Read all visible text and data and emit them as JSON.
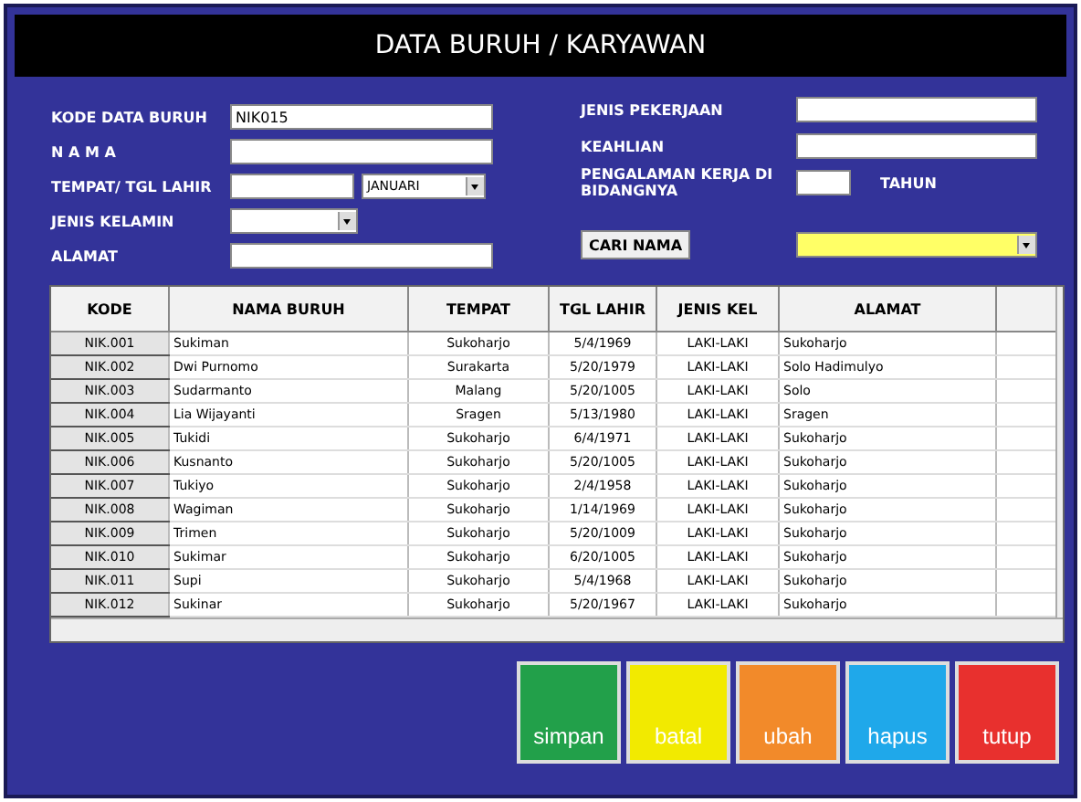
{
  "window": {
    "title": "DATA BURUH / KARYAWAN"
  },
  "form_left": [
    {
      "label": "KODE DATA BURUH",
      "kind": "text",
      "value": "NIK015"
    },
    {
      "label": "N A M A",
      "kind": "text"
    },
    {
      "label": "TEMPAT/ TGL LAHIR",
      "kind": "place-date",
      "month": "JANUARI"
    },
    {
      "label": "JENIS KELAMIN",
      "kind": "combo"
    },
    {
      "label": "ALAMAT",
      "kind": "text"
    }
  ],
  "form_right": [
    {
      "label": "JENIS PEKERJAAN",
      "kind": "text"
    },
    {
      "label": "KEAHLIAN",
      "kind": "text"
    },
    {
      "label": "PENGALAMAN KERJA DI BIDANGNYA",
      "kind": "years",
      "unit": "TAHUN"
    }
  ],
  "search": {
    "button": "CARI NAMA"
  },
  "table": {
    "columns": [
      "KODE",
      "NAMA BURUH",
      "TEMPAT",
      "TGL LAHIR",
      "JENIS KEL",
      "ALAMAT"
    ],
    "rows": [
      [
        "NIK.001",
        "Sukiman",
        "Sukoharjo",
        "5/4/1969",
        "LAKI-LAKI",
        "Sukoharjo"
      ],
      [
        "NIK.002",
        "Dwi Purnomo",
        "Surakarta",
        "5/20/1979",
        "LAKI-LAKI",
        "Solo Hadimulyo"
      ],
      [
        "NIK.003",
        "Sudarmanto",
        "Malang",
        "5/20/1005",
        "LAKI-LAKI",
        "Solo"
      ],
      [
        "NIK.004",
        "Lia Wijayanti",
        "Sragen",
        "5/13/1980",
        "LAKI-LAKI",
        "Sragen"
      ],
      [
        "NIK.005",
        "Tukidi",
        "Sukoharjo",
        "6/4/1971",
        "LAKI-LAKI",
        "Sukoharjo"
      ],
      [
        "NIK.006",
        "Kusnanto",
        "Sukoharjo",
        "5/20/1005",
        "LAKI-LAKI",
        "Sukoharjo"
      ],
      [
        "NIK.007",
        "Tukiyo",
        "Sukoharjo",
        "2/4/1958",
        "LAKI-LAKI",
        "Sukoharjo"
      ],
      [
        "NIK.008",
        "Wagiman",
        "Sukoharjo",
        "1/14/1969",
        "LAKI-LAKI",
        "Sukoharjo"
      ],
      [
        "NIK.009",
        "Trimen",
        "Sukoharjo",
        "5/20/1009",
        "LAKI-LAKI",
        "Sukoharjo"
      ],
      [
        "NIK.010",
        "Sukimar",
        "Sukoharjo",
        "6/20/1005",
        "LAKI-LAKI",
        "Sukoharjo"
      ],
      [
        "NIK.011",
        "Supi",
        "Sukoharjo",
        "5/4/1968",
        "LAKI-LAKI",
        "Sukoharjo"
      ],
      [
        "NIK.012",
        "Sukinar",
        "Sukoharjo",
        "5/20/1967",
        "LAKI-LAKI",
        "Sukoharjo"
      ]
    ]
  },
  "buttons": [
    {
      "label": "simpan",
      "color": "#22a04a"
    },
    {
      "label": "batal",
      "color": "#f2ea00"
    },
    {
      "label": "ubah",
      "color": "#f28a2a"
    },
    {
      "label": "hapus",
      "color": "#1fa8ea"
    },
    {
      "label": "tutup",
      "color": "#e8302e"
    }
  ]
}
